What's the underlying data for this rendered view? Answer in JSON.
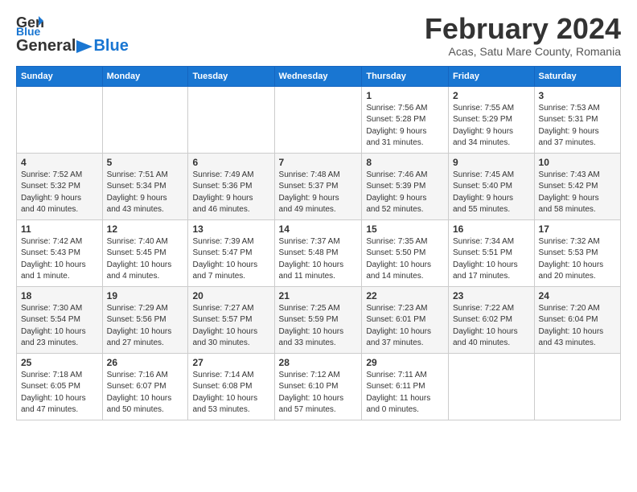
{
  "header": {
    "logo_general": "General",
    "logo_blue": "Blue",
    "month_title": "February 2024",
    "subtitle": "Acas, Satu Mare County, Romania"
  },
  "days_of_week": [
    "Sunday",
    "Monday",
    "Tuesday",
    "Wednesday",
    "Thursday",
    "Friday",
    "Saturday"
  ],
  "weeks": [
    [
      {
        "day": "",
        "info": ""
      },
      {
        "day": "",
        "info": ""
      },
      {
        "day": "",
        "info": ""
      },
      {
        "day": "",
        "info": ""
      },
      {
        "day": "1",
        "info": "Sunrise: 7:56 AM\nSunset: 5:28 PM\nDaylight: 9 hours\nand 31 minutes."
      },
      {
        "day": "2",
        "info": "Sunrise: 7:55 AM\nSunset: 5:29 PM\nDaylight: 9 hours\nand 34 minutes."
      },
      {
        "day": "3",
        "info": "Sunrise: 7:53 AM\nSunset: 5:31 PM\nDaylight: 9 hours\nand 37 minutes."
      }
    ],
    [
      {
        "day": "4",
        "info": "Sunrise: 7:52 AM\nSunset: 5:32 PM\nDaylight: 9 hours\nand 40 minutes."
      },
      {
        "day": "5",
        "info": "Sunrise: 7:51 AM\nSunset: 5:34 PM\nDaylight: 9 hours\nand 43 minutes."
      },
      {
        "day": "6",
        "info": "Sunrise: 7:49 AM\nSunset: 5:36 PM\nDaylight: 9 hours\nand 46 minutes."
      },
      {
        "day": "7",
        "info": "Sunrise: 7:48 AM\nSunset: 5:37 PM\nDaylight: 9 hours\nand 49 minutes."
      },
      {
        "day": "8",
        "info": "Sunrise: 7:46 AM\nSunset: 5:39 PM\nDaylight: 9 hours\nand 52 minutes."
      },
      {
        "day": "9",
        "info": "Sunrise: 7:45 AM\nSunset: 5:40 PM\nDaylight: 9 hours\nand 55 minutes."
      },
      {
        "day": "10",
        "info": "Sunrise: 7:43 AM\nSunset: 5:42 PM\nDaylight: 9 hours\nand 58 minutes."
      }
    ],
    [
      {
        "day": "11",
        "info": "Sunrise: 7:42 AM\nSunset: 5:43 PM\nDaylight: 10 hours\nand 1 minute."
      },
      {
        "day": "12",
        "info": "Sunrise: 7:40 AM\nSunset: 5:45 PM\nDaylight: 10 hours\nand 4 minutes."
      },
      {
        "day": "13",
        "info": "Sunrise: 7:39 AM\nSunset: 5:47 PM\nDaylight: 10 hours\nand 7 minutes."
      },
      {
        "day": "14",
        "info": "Sunrise: 7:37 AM\nSunset: 5:48 PM\nDaylight: 10 hours\nand 11 minutes."
      },
      {
        "day": "15",
        "info": "Sunrise: 7:35 AM\nSunset: 5:50 PM\nDaylight: 10 hours\nand 14 minutes."
      },
      {
        "day": "16",
        "info": "Sunrise: 7:34 AM\nSunset: 5:51 PM\nDaylight: 10 hours\nand 17 minutes."
      },
      {
        "day": "17",
        "info": "Sunrise: 7:32 AM\nSunset: 5:53 PM\nDaylight: 10 hours\nand 20 minutes."
      }
    ],
    [
      {
        "day": "18",
        "info": "Sunrise: 7:30 AM\nSunset: 5:54 PM\nDaylight: 10 hours\nand 23 minutes."
      },
      {
        "day": "19",
        "info": "Sunrise: 7:29 AM\nSunset: 5:56 PM\nDaylight: 10 hours\nand 27 minutes."
      },
      {
        "day": "20",
        "info": "Sunrise: 7:27 AM\nSunset: 5:57 PM\nDaylight: 10 hours\nand 30 minutes."
      },
      {
        "day": "21",
        "info": "Sunrise: 7:25 AM\nSunset: 5:59 PM\nDaylight: 10 hours\nand 33 minutes."
      },
      {
        "day": "22",
        "info": "Sunrise: 7:23 AM\nSunset: 6:01 PM\nDaylight: 10 hours\nand 37 minutes."
      },
      {
        "day": "23",
        "info": "Sunrise: 7:22 AM\nSunset: 6:02 PM\nDaylight: 10 hours\nand 40 minutes."
      },
      {
        "day": "24",
        "info": "Sunrise: 7:20 AM\nSunset: 6:04 PM\nDaylight: 10 hours\nand 43 minutes."
      }
    ],
    [
      {
        "day": "25",
        "info": "Sunrise: 7:18 AM\nSunset: 6:05 PM\nDaylight: 10 hours\nand 47 minutes."
      },
      {
        "day": "26",
        "info": "Sunrise: 7:16 AM\nSunset: 6:07 PM\nDaylight: 10 hours\nand 50 minutes."
      },
      {
        "day": "27",
        "info": "Sunrise: 7:14 AM\nSunset: 6:08 PM\nDaylight: 10 hours\nand 53 minutes."
      },
      {
        "day": "28",
        "info": "Sunrise: 7:12 AM\nSunset: 6:10 PM\nDaylight: 10 hours\nand 57 minutes."
      },
      {
        "day": "29",
        "info": "Sunrise: 7:11 AM\nSunset: 6:11 PM\nDaylight: 11 hours\nand 0 minutes."
      },
      {
        "day": "",
        "info": ""
      },
      {
        "day": "",
        "info": ""
      }
    ]
  ]
}
